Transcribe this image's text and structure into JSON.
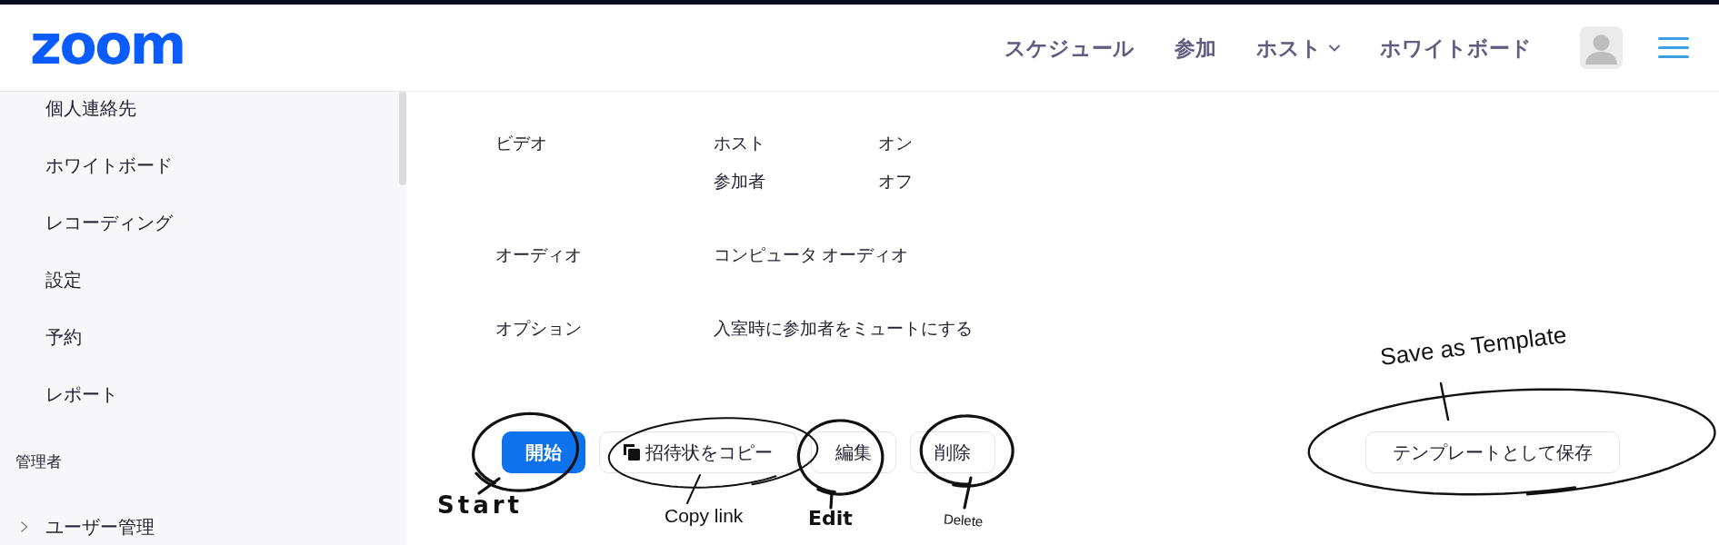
{
  "header": {
    "logo": "zoom",
    "nav": [
      {
        "label": "スケジュール",
        "kind": "link"
      },
      {
        "label": "参加",
        "kind": "link"
      },
      {
        "label": "ホスト",
        "kind": "dropdown"
      },
      {
        "label": "ホワイトボード",
        "kind": "link"
      }
    ]
  },
  "sidebar": {
    "items": [
      {
        "label": "個人連絡先",
        "kind": "item"
      },
      {
        "label": "ホワイトボード",
        "kind": "item"
      },
      {
        "label": "レコーディング",
        "kind": "item"
      },
      {
        "label": "設定",
        "kind": "item"
      },
      {
        "label": "予約",
        "kind": "item"
      },
      {
        "label": "レポート",
        "kind": "item"
      },
      {
        "label": "管理者",
        "kind": "section"
      },
      {
        "label": "ユーザー管理",
        "kind": "group",
        "expanded": false
      }
    ]
  },
  "details": [
    {
      "label": "ビデオ",
      "entries": [
        {
          "name": "ホスト",
          "value": "オン"
        },
        {
          "name": "参加者",
          "value": "オフ"
        }
      ]
    },
    {
      "label": "オーディオ",
      "value": "コンピュータ オーディオ"
    },
    {
      "label": "オプション",
      "value": "入室時に参加者をミュートにする"
    }
  ],
  "actions": [
    {
      "label": "開始",
      "kind": "primary",
      "annotation": "Start"
    },
    {
      "label": "招待状をコピー",
      "kind": "copy",
      "annotation": "Copy link"
    },
    {
      "label": "編集",
      "kind": "plain",
      "annotation": "Edit"
    },
    {
      "label": "削除",
      "kind": "plain",
      "annotation": "Delete"
    }
  ],
  "template_button": {
    "label": "テンプレートとして保存",
    "annotation": "Save as Template"
  }
}
